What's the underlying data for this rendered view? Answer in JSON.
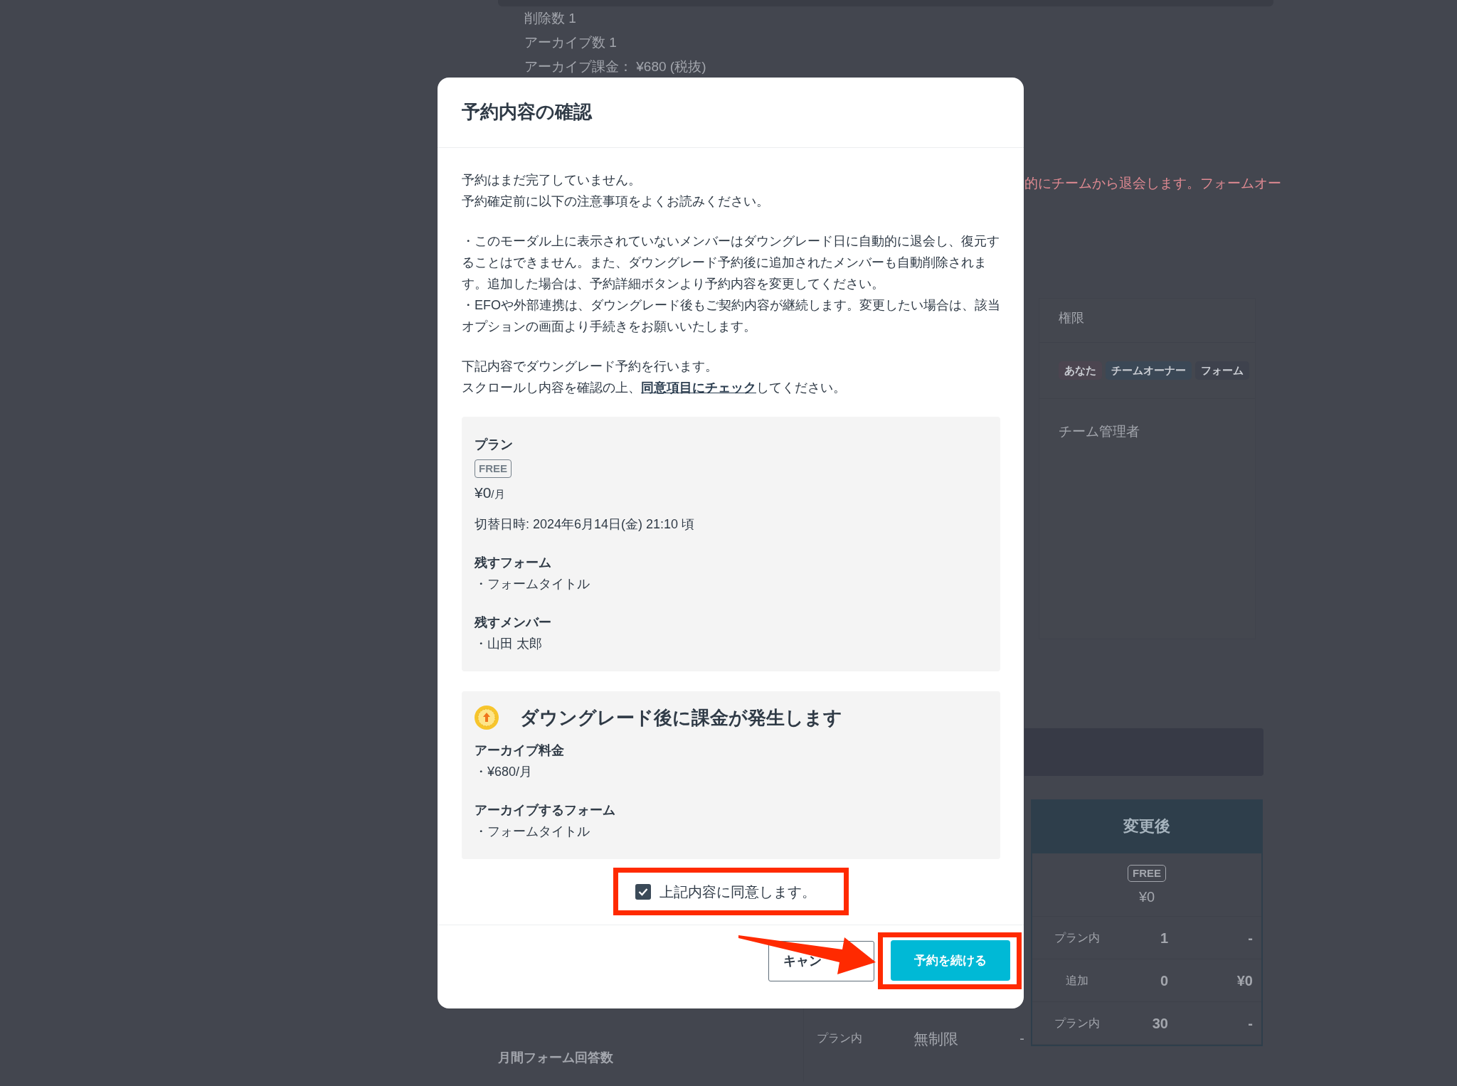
{
  "background_page": {
    "summary_lines": [
      "削除数 1",
      "アーカイブ数 1",
      "アーカイブ課金： ¥680 (税抜)"
    ],
    "warning_text": "的にチームから退会します。フォームオー",
    "permission_card": {
      "heading": "権限",
      "badges": [
        {
          "label": "あなた",
          "color": "#4c4550"
        },
        {
          "label": "チームオーナー",
          "color": "#3b4856"
        },
        {
          "label": "フォーム",
          "color": "#3e424d"
        }
      ],
      "role": "チーム管理者"
    },
    "comparison": {
      "after_header": "変更後",
      "plan_badge": "FREE",
      "price": "¥0",
      "rows": [
        {
          "label": "プラン内",
          "value": "1",
          "fee": "-"
        },
        {
          "label": "追加",
          "value": "0",
          "fee": "¥0"
        },
        {
          "label": "プラン内",
          "value": "30",
          "fee": "-"
        }
      ]
    },
    "left_table": {
      "sub_label": "プラン内",
      "value": "無制限",
      "fee": "-",
      "row_label": "月間フォーム回答数"
    }
  },
  "modal": {
    "title": "予約内容の確認",
    "intro": [
      "予約はまだ完了していません。",
      "予約確定前に以下の注意事項をよくお読みください。"
    ],
    "notes": [
      "・このモーダル上に表示されていないメンバーはダウングレード日に自動的に退会し、復元することはできません。また、ダウングレード予約後に追加されたメンバーも自動削除されます。追加した場合は、予約詳細ボタンより予約内容を変更してください。",
      "・EFOや外部連携は、ダウングレード後もご契約内容が継続します。変更したい場合は、該当オプションの画面より手続きをお願いいたします。"
    ],
    "instruction": "下記内容でダウングレード予約を行います。",
    "instruction2": {
      "before": "スクロールし内容を確認の上、",
      "link": "同意項目にチェック",
      "after": "してください。"
    },
    "plan_box": {
      "heading": "プラン",
      "plan_badge": "FREE",
      "price_amount": "¥0",
      "price_unit": "/月",
      "switch_time": "切替日時: 2024年6月14日(金) 21:10 頃",
      "sections": [
        {
          "heading": "残すフォーム",
          "item": "・フォームタイトル"
        },
        {
          "heading": "残すメンバー",
          "item": "・山田 太郎"
        }
      ]
    },
    "charge_box": {
      "heading": "ダウングレード後に課金が発生します",
      "sections": [
        {
          "heading": "アーカイブ料金",
          "item": "・¥680/月"
        },
        {
          "heading": "アーカイブするフォーム",
          "item": "・フォームタイトル"
        }
      ]
    },
    "agreement": {
      "label": "上記内容に同意します。",
      "checked": true
    },
    "buttons": [
      {
        "kind": "cancel",
        "label": "キャン"
      },
      {
        "kind": "primary",
        "label": "予約を続ける"
      }
    ]
  }
}
